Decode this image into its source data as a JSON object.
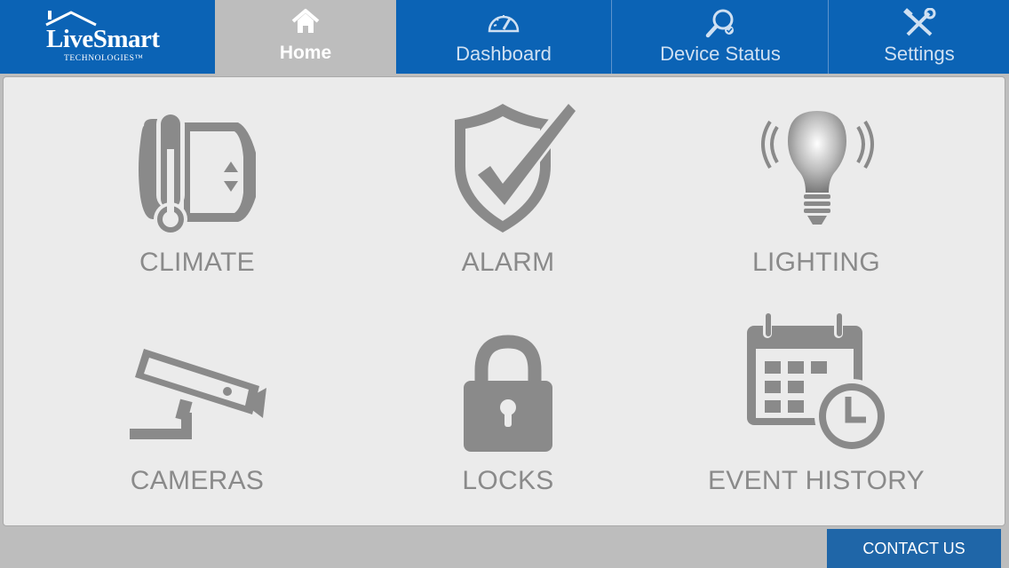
{
  "brand": {
    "name": "LiveSmart",
    "subtitle": "TECHNOLOGIES™"
  },
  "nav": {
    "tabs": [
      {
        "label": "Home",
        "icon": "home-icon",
        "active": true
      },
      {
        "label": "Dashboard",
        "icon": "gauge-icon",
        "active": false
      },
      {
        "label": "Device Status",
        "icon": "magnifier-check-icon",
        "active": false
      },
      {
        "label": "Settings",
        "icon": "tools-icon",
        "active": false
      }
    ]
  },
  "tiles": [
    {
      "label": "CLIMATE",
      "icon": "thermostat-icon"
    },
    {
      "label": "ALARM",
      "icon": "shield-check-icon"
    },
    {
      "label": "LIGHTING",
      "icon": "lightbulb-icon"
    },
    {
      "label": "CAMERAS",
      "icon": "security-camera-icon"
    },
    {
      "label": "LOCKS",
      "icon": "padlock-icon"
    },
    {
      "label": "EVENT HISTORY",
      "icon": "calendar-clock-icon"
    }
  ],
  "footer": {
    "contact_label": "CONTACT US"
  },
  "colors": {
    "nav_blue": "#0b63b5",
    "active_tab": "#bdbdbd",
    "icon_gray": "#8a8a8a",
    "panel_bg": "#ebebeb",
    "contact_blue": "#1f66a8"
  }
}
